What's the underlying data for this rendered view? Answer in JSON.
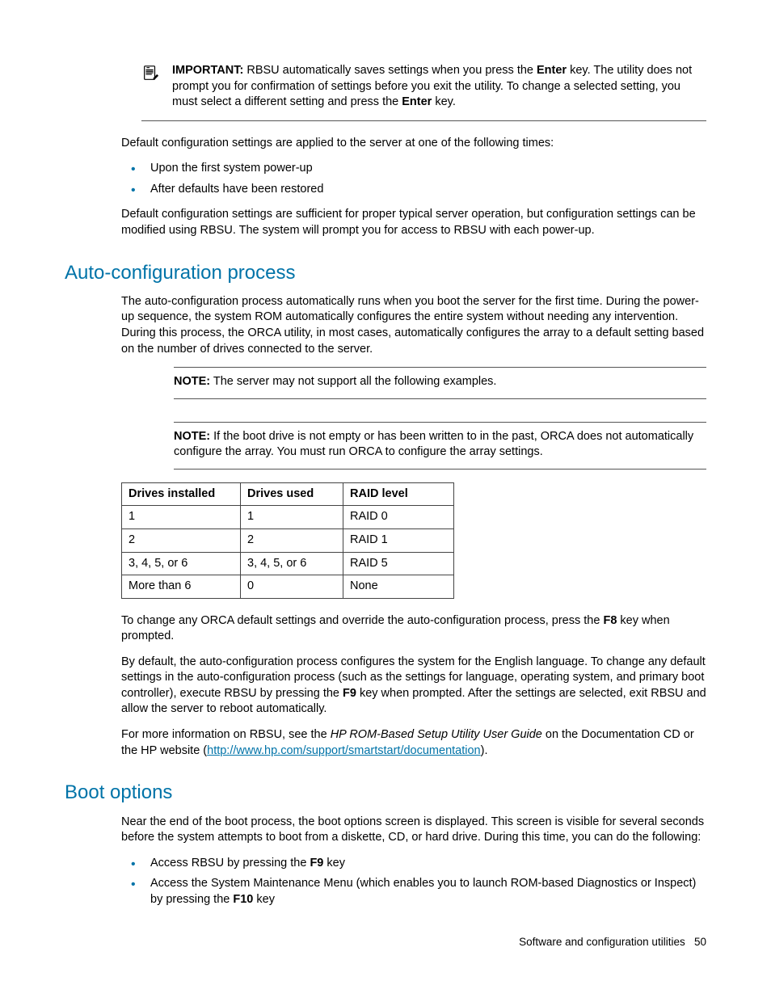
{
  "important": {
    "label": "IMPORTANT:",
    "pre1": " RBSU automatically saves settings when you press the ",
    "key1": "Enter",
    "post1": " key. The utility does not prompt you for confirmation of settings before you exit the utility. To change a selected setting, you must select a different setting and press the ",
    "key2": "Enter",
    "post2": " key."
  },
  "para_default_intro": "Default configuration settings are applied to the server at one of the following times:",
  "bullets1": [
    "Upon the first system power-up",
    "After defaults have been restored"
  ],
  "para_default_suff": "Default configuration settings are sufficient for proper typical server operation, but configuration settings can be modified using RBSU. The system will prompt you for access to RBSU with each power-up.",
  "section1": "Auto-configuration process",
  "para_auto": "The auto-configuration process automatically runs when you boot the server for the first time. During the power-up sequence, the system ROM automatically configures the entire system without needing any intervention. During this process, the ORCA utility, in most cases, automatically configures the array to a default setting based on the number of drives connected to the server.",
  "note1": {
    "label": "NOTE:",
    "text": "  The server may not support all the following examples."
  },
  "note2": {
    "label": "NOTE:",
    "text": "  If the boot drive is not empty or has been written to in the past, ORCA does not automatically configure the array. You must run ORCA to configure the array settings."
  },
  "table": {
    "headers": [
      "Drives installed",
      "Drives used",
      "RAID level"
    ],
    "rows": [
      [
        "1",
        "1",
        "RAID 0"
      ],
      [
        "2",
        "2",
        "RAID 1"
      ],
      [
        "3, 4, 5, or 6",
        "3, 4, 5, or 6",
        "RAID 5"
      ],
      [
        "More than 6",
        "0",
        "None"
      ]
    ]
  },
  "para_orca": {
    "pre": "To change any ORCA default settings and override the auto-configuration process, press the ",
    "key": "F8",
    "post": " key when prompted."
  },
  "para_english": {
    "pre": "By default, the auto-configuration process configures the system for the English language. To change any default settings in the auto-configuration process (such as the settings for language, operating system, and primary boot controller), execute RBSU by pressing the ",
    "key": "F9",
    "post": " key when prompted. After the settings are selected, exit RBSU and allow the server to reboot automatically."
  },
  "para_more": {
    "pre": "For more information on RBSU, see the ",
    "em": "HP ROM-Based Setup Utility User Guide",
    "mid": " on the Documentation CD or the HP website (",
    "link": "http://www.hp.com/support/smartstart/documentation",
    "post": ")."
  },
  "section2": "Boot options",
  "para_boot": "Near the end of the boot process, the boot options screen is displayed. This screen is visible for several seconds before the system attempts to boot from a diskette, CD, or hard drive. During this time, you can do the following:",
  "bullets2": {
    "i1": {
      "pre": "Access RBSU by pressing the ",
      "key": "F9",
      "post": " key"
    },
    "i2": {
      "pre": "Access the System Maintenance Menu (which enables you to launch ROM-based Diagnostics or Inspect) by pressing the ",
      "key": "F10",
      "post": " key"
    }
  },
  "footer": {
    "text": "Software and configuration utilities",
    "page": "50"
  }
}
